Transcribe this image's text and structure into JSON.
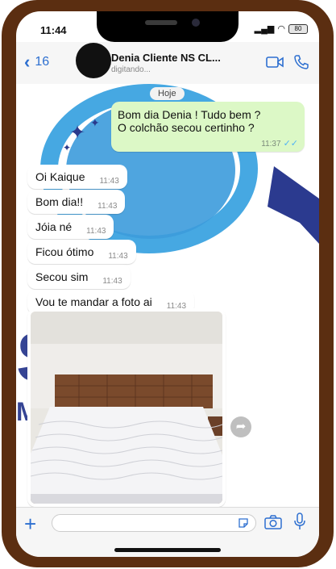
{
  "status": {
    "time": "11:44",
    "battery": "80"
  },
  "header": {
    "back_count": "16",
    "contact_name": "Denia Cliente NS CL...",
    "contact_status": "digitando..."
  },
  "chat": {
    "day_label": "Hoje",
    "outgoing": {
      "line1": "Bom dia Denia ! Tudo bem ?",
      "line2": "O colchão secou certinho ?",
      "time": "11:37"
    },
    "incoming": [
      {
        "text": "Oi Kaique",
        "time": "11:43"
      },
      {
        "text": "Bom dia!!",
        "time": "11:43"
      },
      {
        "text": "Jóia né",
        "time": "11:43"
      },
      {
        "text": "Ficou ótimo",
        "time": "11:43"
      },
      {
        "text": "Secou sim",
        "time": "11:43"
      },
      {
        "text": "Vou te mandar a foto ai",
        "time": "11:43"
      }
    ],
    "watermark": {
      "big": "S EA",
      "sub": "M O DE EST"
    }
  },
  "colors": {
    "outgoing_bubble": "#dcf8c6",
    "accent": "#2d6fd0",
    "phone_frame": "#5b2e11",
    "watermark_blue": "#46a8e2",
    "watermark_navy": "#2b3a8f"
  },
  "icons": [
    "back-arrow-icon",
    "video-call-icon",
    "phone-call-icon",
    "forward-icon",
    "plus-icon",
    "sticker-icon",
    "camera-icon",
    "microphone-icon",
    "read-ticks-icon"
  ]
}
